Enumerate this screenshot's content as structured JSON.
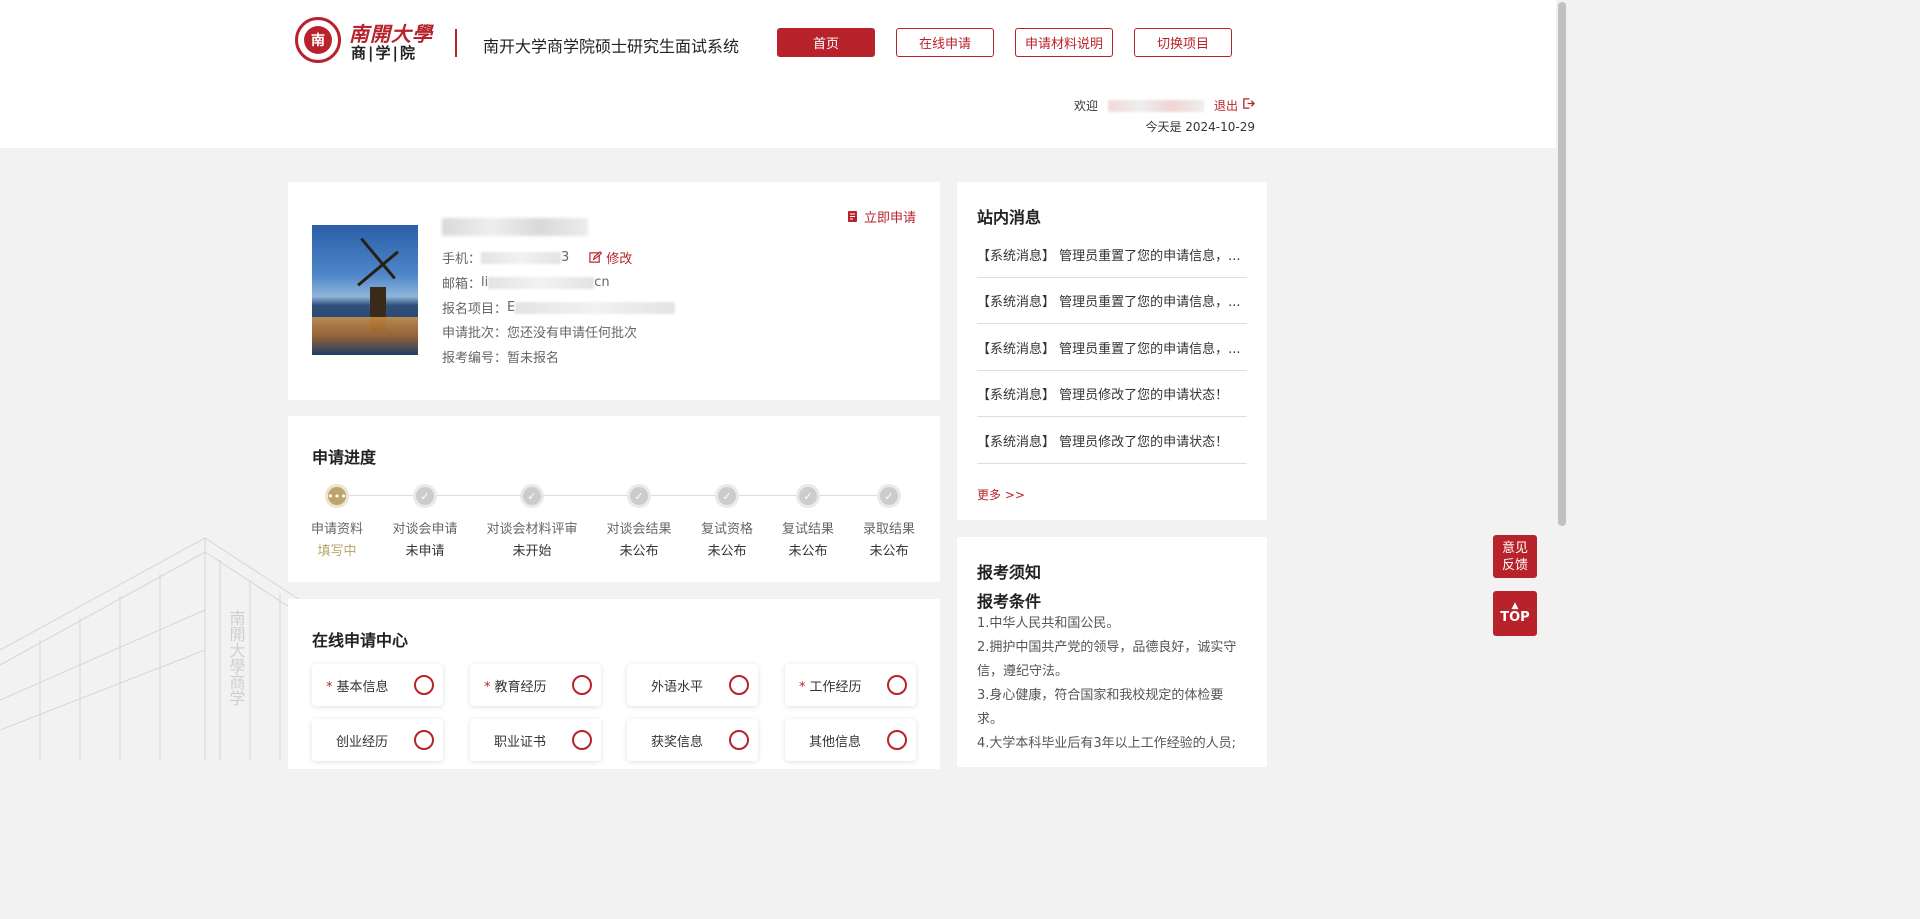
{
  "header": {
    "logo_seal_text": "南",
    "logo_line1": "南開大學",
    "logo_line2": "商|学|院",
    "system_title": "南开大学商学院硕士研究生面试系统",
    "nav": [
      {
        "label": "首页",
        "active": true
      },
      {
        "label": "在线申请",
        "active": false
      },
      {
        "label": "申请材料说明",
        "active": false
      },
      {
        "label": "切换项目",
        "active": false
      }
    ],
    "welcome_label": "欢迎",
    "logout_label": "退出",
    "today_label": "今天是 2024-10-29"
  },
  "profile": {
    "apply_now_label": "立即申请",
    "phone_label": "手机：",
    "phone_suffix": "3",
    "edit_label": "修改",
    "email_label": "邮箱：",
    "email_prefix": "li",
    "email_suffix": "cn",
    "project_label": "报名项目：",
    "project_prefix": "E",
    "batch_label": "申请批次：",
    "batch_value": "您还没有申请任何批次",
    "exam_no_label": "报考编号：",
    "exam_no_value": "暂未报名"
  },
  "progress": {
    "title": "申请进度",
    "current_dot": "•••",
    "done_dot": "✓",
    "steps": [
      {
        "label": "申请资料",
        "status": "填写中",
        "current": true
      },
      {
        "label": "对谈会申请",
        "status": "未申请",
        "current": false
      },
      {
        "label": "对谈会材料评审",
        "status": "未开始",
        "current": false
      },
      {
        "label": "对谈会结果",
        "status": "未公布",
        "current": false
      },
      {
        "label": "复试资格",
        "status": "未公布",
        "current": false
      },
      {
        "label": "复试结果",
        "status": "未公布",
        "current": false
      },
      {
        "label": "录取结果",
        "status": "未公布",
        "current": false
      }
    ]
  },
  "center": {
    "title": "在线申请中心",
    "required_mark": "*",
    "items": [
      {
        "label": "基本信息",
        "required": true
      },
      {
        "label": "教育经历",
        "required": true
      },
      {
        "label": "外语水平",
        "required": false
      },
      {
        "label": "工作经历",
        "required": true
      },
      {
        "label": "创业经历",
        "required": false
      },
      {
        "label": "职业证书",
        "required": false
      },
      {
        "label": "获奖信息",
        "required": false
      },
      {
        "label": "其他信息",
        "required": false
      }
    ]
  },
  "messages": {
    "title": "站内消息",
    "items": [
      "【系统消息】 管理员重置了您的申请信息，...",
      "【系统消息】 管理员重置了您的申请信息，...",
      "【系统消息】 管理员重置了您的申请信息，...",
      "【系统消息】 管理员修改了您的申请状态！",
      "【系统消息】 管理员修改了您的申请状态！"
    ],
    "more_label": "更多 >>"
  },
  "notice": {
    "title": "报考须知",
    "subtitle": "报考条件",
    "lines": [
      "1.中华人民共和国公民。",
      "2.拥护中国共产党的领导，品德良好，诚实守信，遵纪守法。",
      "3.身心健康，符合国家和我校规定的体检要求。",
      "4.大学本科毕业后有3年以上工作经验的人员;"
    ]
  },
  "floating": {
    "feedback_label": "意见反馈",
    "top_label": "TOP",
    "top_arrow": "▲"
  },
  "colors": {
    "brand": "#b8232b",
    "current_step": "#bca46a",
    "done_step": "#cccccc"
  }
}
